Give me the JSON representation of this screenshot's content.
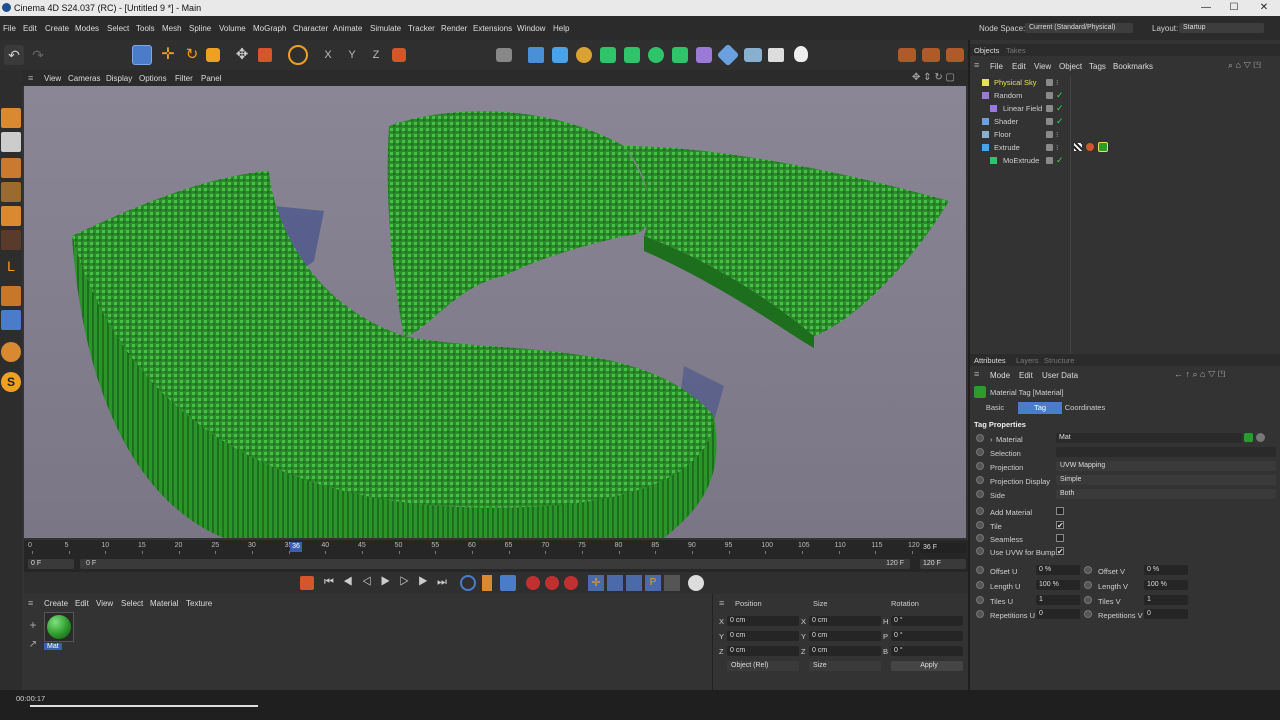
{
  "window": {
    "title": "Cinema 4D S24.037 (RC) - [Untitled 9 *] - Main",
    "min": "—",
    "max": "☐",
    "close": "✕"
  },
  "menu": [
    "File",
    "Edit",
    "Create",
    "Modes",
    "Select",
    "Tools",
    "Mesh",
    "Spline",
    "Volume",
    "MoGraph",
    "Character",
    "Animate",
    "Simulate",
    "Tracker",
    "Render",
    "Extensions",
    "Window",
    "Help"
  ],
  "nodespace": {
    "label": "Node Space:",
    "value": "Current (Standard/Physical)"
  },
  "layout": {
    "label": "Layout:",
    "value": "Startup"
  },
  "viewport_menu": [
    "View",
    "Cameras",
    "Display",
    "Options",
    "Filter",
    "Panel"
  ],
  "timeline": {
    "ticks": [
      "0",
      "5",
      "10",
      "15",
      "20",
      "25",
      "30",
      "35",
      "40",
      "45",
      "50",
      "55",
      "60",
      "65",
      "70",
      "75",
      "80",
      "85",
      "90",
      "95",
      "100",
      "105",
      "110",
      "115",
      "120"
    ],
    "current_marker": "36",
    "frame_display": "36 F",
    "start": "0 F",
    "range_start": "0 F",
    "range_end": "120 F",
    "end": "120 F",
    "current_frame": 36,
    "max_frame": 120
  },
  "material_manager": {
    "menu": [
      "Create",
      "Edit",
      "View",
      "Select",
      "Material",
      "Texture"
    ],
    "materials": [
      {
        "name": "Mat"
      }
    ]
  },
  "coordinates": {
    "headers": [
      "Position",
      "Size",
      "Rotation"
    ],
    "rows": [
      {
        "axis": "X",
        "pos": "0 cm",
        "saxis": "X",
        "size": "0 cm",
        "raxis": "H",
        "rot": "0 °"
      },
      {
        "axis": "Y",
        "pos": "0 cm",
        "saxis": "Y",
        "size": "0 cm",
        "raxis": "P",
        "rot": "0 °"
      },
      {
        "axis": "Z",
        "pos": "0 cm",
        "saxis": "Z",
        "size": "0 cm",
        "raxis": "B",
        "rot": "0 °"
      }
    ],
    "mode": "Object (Rel)",
    "size_mode": "Size",
    "apply": "Apply"
  },
  "status": {
    "time": "00:00:17"
  },
  "objects_panel": {
    "tabs": [
      "Objects",
      "Takes"
    ],
    "menu": [
      "File",
      "Edit",
      "View",
      "Object",
      "Tags",
      "Bookmarks"
    ],
    "items": [
      {
        "name": "Physical Sky",
        "indent": 0,
        "color": "#e8e05a"
      },
      {
        "name": "Random",
        "indent": 0,
        "color": "#cfcfcf"
      },
      {
        "name": "Linear Field",
        "indent": 1,
        "color": "#cfcfcf"
      },
      {
        "name": "Shader",
        "indent": 0,
        "color": "#cfcfcf"
      },
      {
        "name": "Floor",
        "indent": 0,
        "color": "#cfcfcf"
      },
      {
        "name": "Extrude",
        "indent": 0,
        "color": "#cfcfcf"
      },
      {
        "name": "MoExtrude",
        "indent": 1,
        "color": "#cfcfcf"
      }
    ]
  },
  "attributes": {
    "tabs": [
      "Attributes",
      "Layers",
      "Structure"
    ],
    "menu": [
      "Mode",
      "Edit",
      "User Data"
    ],
    "title": "Material Tag [Material]",
    "subtabs": [
      "Basic",
      "Tag",
      "Coordinates"
    ],
    "section": "Tag Properties",
    "material": {
      "label": "Material",
      "value": "Mat"
    },
    "selection": {
      "label": "Selection",
      "value": ""
    },
    "projection": {
      "label": "Projection",
      "value": "UVW Mapping"
    },
    "projection_display": {
      "label": "Projection Display",
      "value": "Simple"
    },
    "side": {
      "label": "Side",
      "value": "Both"
    },
    "add_material": {
      "label": "Add Material",
      "checked": ""
    },
    "tile": {
      "label": "Tile",
      "checked": "✔"
    },
    "seamless": {
      "label": "Seamless",
      "checked": ""
    },
    "use_uvw": {
      "label": "Use UVW for Bump",
      "checked": "✔"
    },
    "offset_u": {
      "label": "Offset U",
      "value": "0 %"
    },
    "offset_v": {
      "label": "Offset V",
      "value": "0 %"
    },
    "length_u": {
      "label": "Length U",
      "value": "100 %"
    },
    "length_v": {
      "label": "Length V",
      "value": "100 %"
    },
    "tiles_u": {
      "label": "Tiles U",
      "value": "1"
    },
    "tiles_v": {
      "label": "Tiles V",
      "value": "1"
    },
    "rep_u": {
      "label": "Repetitions U",
      "value": "0"
    },
    "rep_v": {
      "label": "Repetitions V",
      "value": "0"
    }
  },
  "colors": {
    "accent": "#4a7cc9",
    "grass": "#2e9a2e",
    "viewport_bg": "#7e7a8a"
  }
}
